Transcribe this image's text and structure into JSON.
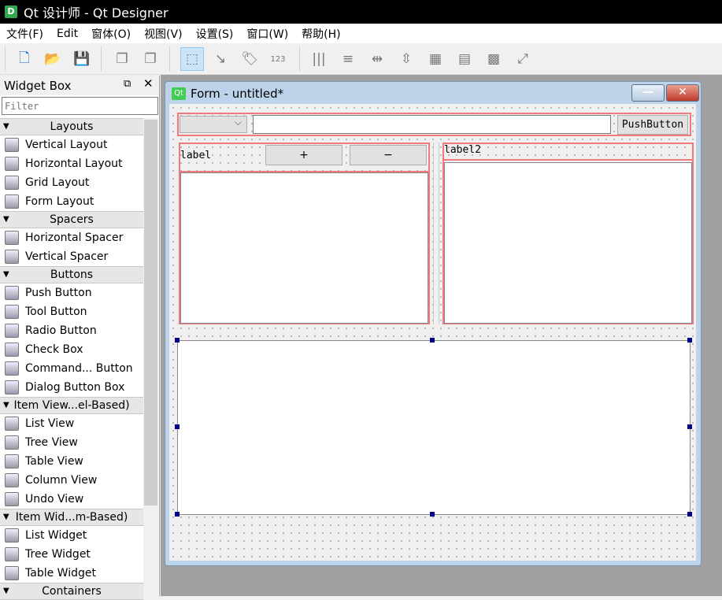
{
  "app": {
    "title": "Qt 设计师 - Qt Designer",
    "icon_letter": "D"
  },
  "menu": [
    "文件(F)",
    "Edit",
    "窗体(O)",
    "视图(V)",
    "设置(S)",
    "窗口(W)",
    "帮助(H)"
  ],
  "toolbar": [
    "new-file-icon",
    "open-folder-icon",
    "save-icon",
    "send-to-back-icon",
    "bring-to-front-icon",
    "edit-widgets-icon",
    "edit-signals-slots-icon",
    "edit-buddies-icon",
    "edit-tab-order-icon",
    "layout-horizontal-icon",
    "layout-vertical-icon",
    "layout-horizontal-splitter-icon",
    "layout-vertical-splitter-icon",
    "layout-grid-icon",
    "layout-form-icon",
    "break-layout-icon",
    "adjust-size-icon"
  ],
  "widget_box": {
    "title": "Widget Box",
    "filter_placeholder": "Filter",
    "categories": [
      {
        "label": "Layouts",
        "items": [
          "Vertical Layout",
          "Horizontal Layout",
          "Grid Layout",
          "Form Layout"
        ]
      },
      {
        "label": "Spacers",
        "items": [
          "Horizontal Spacer",
          "Vertical Spacer"
        ]
      },
      {
        "label": "Buttons",
        "items": [
          "Push Button",
          "Tool Button",
          "Radio Button",
          "Check Box",
          "Command... Button",
          "Dialog Button Box"
        ]
      },
      {
        "label": "Item View...el-Based)",
        "items": [
          "List View",
          "Tree View",
          "Table View",
          "Column View",
          "Undo View"
        ]
      },
      {
        "label": "Item Wid...m-Based)",
        "items": [
          "List Widget",
          "Tree Widget",
          "Table Widget"
        ]
      },
      {
        "label": "Containers",
        "items": []
      }
    ]
  },
  "form": {
    "title": "Form - untitled*",
    "icon": "Qt",
    "combo_value": "",
    "line_edit_value": "",
    "push_button": "PushButton",
    "label1": "label",
    "plus": "+",
    "minus": "−",
    "label2": "label2"
  }
}
